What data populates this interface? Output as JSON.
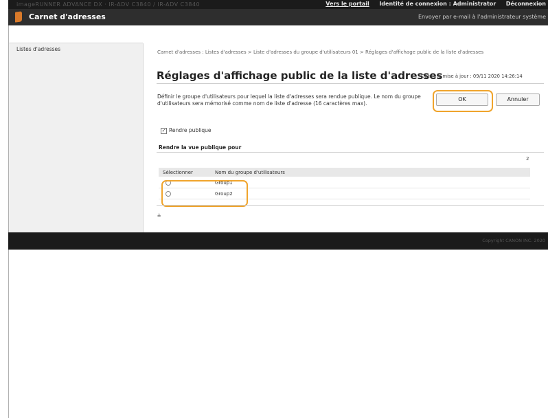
{
  "topbar": {
    "device": "imageRUNNER ADVANCE DX  ·  IR-ADV C3840 / IR-ADV C3840",
    "portal_link": "Vers le portail",
    "login_id": "Identité de connexion : Administrator",
    "logout": "Déconnexion"
  },
  "header": {
    "title": "Carnet d'adresses",
    "mail_admin": "Envoyer par e-mail à l'administrateur système"
  },
  "sidebar": {
    "items": [
      {
        "label": "Listes d'adresses"
      }
    ]
  },
  "main": {
    "breadcrumb": "Carnet d'adresses : Listes d'adresses > Liste d'adresses du groupe d'utilisateurs 01 > Réglages d'affichage public de la liste d'adresses",
    "title": "Réglages d'affichage public de la liste d'adresses",
    "last_updated": "Dernière mise à jour : 09/11 2020 14:26:14",
    "description": "Définir le groupe d'utilisateurs pour lequel la liste d'adresses sera rendue publique. Le nom du groupe d'utilisateurs sera mémorisé comme nom de liste d'adresse (16 caractères max).",
    "ok_label": "OK",
    "cancel_label": "Annuler",
    "checkbox_label": "Rendre publique",
    "checkbox_checked": true,
    "section_label": "Rendre la vue publique pour",
    "count": "2",
    "table": {
      "col_select": "Sélectionner",
      "col_name": "Nom du groupe d'utilisateurs",
      "rows": [
        {
          "name": "Group1"
        },
        {
          "name": "Group2"
        }
      ]
    },
    "to_top_glyph": "⩮"
  },
  "footer": {
    "copyright": "Copyright CANON INC. 2020"
  },
  "colors": {
    "highlight": "#f0a42c",
    "header_bg": "#2e2e2e",
    "topbar_bg": "#1b1b1b",
    "logo": "#d97a2a"
  }
}
